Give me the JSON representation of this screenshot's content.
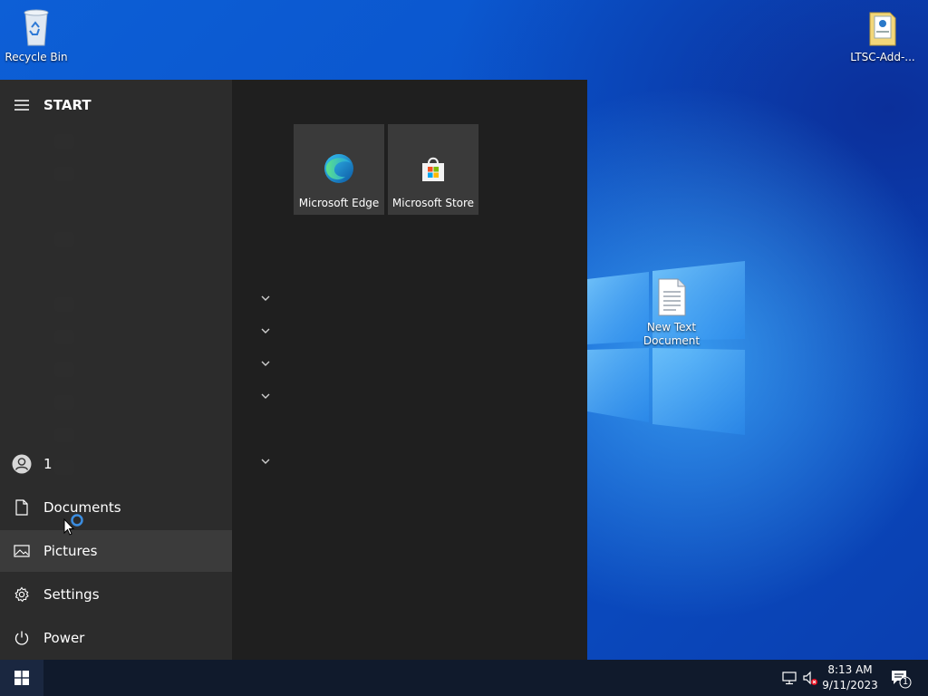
{
  "desktop": {
    "icons": [
      {
        "label": "Recycle Bin"
      },
      {
        "label": "LTSC-Add-..."
      },
      {
        "label": "New Text Document"
      }
    ]
  },
  "start_menu": {
    "title": "START",
    "rail": {
      "user_label": "1",
      "documents_label": "Documents",
      "pictures_label": "Pictures",
      "settings_label": "Settings",
      "power_label": "Power"
    },
    "tiles": [
      {
        "label": "Microsoft Edge",
        "icon": "edge-icon"
      },
      {
        "label": "Microsoft Store",
        "icon": "store-icon"
      }
    ]
  },
  "taskbar": {
    "time": "8:13 AM",
    "date": "9/11/2023",
    "notification_count": "1"
  },
  "colors": {
    "menu_bg": "#1f1f1f",
    "rail_bg": "#2d2d2d",
    "tile_bg": "#3a3a3a",
    "taskbar_bg": "#101a2c",
    "hover_bg": "#3b3b3b"
  }
}
